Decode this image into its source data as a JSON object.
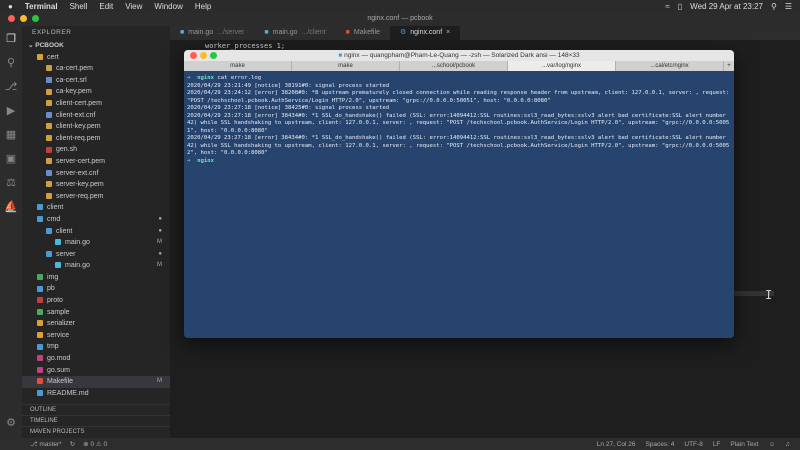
{
  "menubar": {
    "apple": "",
    "app_name": "Terminal",
    "items": [
      "Shell",
      "Edit",
      "View",
      "Window",
      "Help"
    ],
    "clock": "Wed 29 Apr at 23:27"
  },
  "window_title": "nginx.conf — pcbook",
  "sidebar": {
    "header": "EXPLORER",
    "root": "PCBOOK",
    "items": [
      {
        "label": "cert",
        "color": "#e0a030",
        "indent": 1,
        "badge": ""
      },
      {
        "label": "ca-cert.pem",
        "color": "#d0a040",
        "indent": 2,
        "badge": ""
      },
      {
        "label": "ca-cert.srl",
        "color": "#6c8cc8",
        "indent": 2,
        "badge": ""
      },
      {
        "label": "ca-key.pem",
        "color": "#d0a040",
        "indent": 2,
        "badge": ""
      },
      {
        "label": "client-cert.pem",
        "color": "#d0a040",
        "indent": 2,
        "badge": ""
      },
      {
        "label": "client-ext.cnf",
        "color": "#6c8cc8",
        "indent": 2,
        "badge": ""
      },
      {
        "label": "client-key.pem",
        "color": "#d0a040",
        "indent": 2,
        "badge": ""
      },
      {
        "label": "client-req.pem",
        "color": "#d0a040",
        "indent": 2,
        "badge": ""
      },
      {
        "label": "gen.sh",
        "color": "#c04040",
        "indent": 2,
        "badge": ""
      },
      {
        "label": "server-cert.pem",
        "color": "#d0a040",
        "indent": 2,
        "badge": ""
      },
      {
        "label": "server-ext.cnf",
        "color": "#6c8cc8",
        "indent": 2,
        "badge": ""
      },
      {
        "label": "server-key.pem",
        "color": "#d0a040",
        "indent": 2,
        "badge": ""
      },
      {
        "label": "server-req.pem",
        "color": "#d0a040",
        "indent": 2,
        "badge": ""
      },
      {
        "label": "client",
        "color": "#4a9ad8",
        "indent": 1,
        "badge": ""
      },
      {
        "label": "cmd",
        "color": "#4a9ad8",
        "indent": 1,
        "badge": "●"
      },
      {
        "label": "client",
        "color": "#4a9ad8",
        "indent": 2,
        "badge": "●"
      },
      {
        "label": "main.go",
        "color": "#4ab8d8",
        "indent": 3,
        "badge": "M"
      },
      {
        "label": "server",
        "color": "#4a9ad8",
        "indent": 2,
        "badge": "●"
      },
      {
        "label": "main.go",
        "color": "#4ab8d8",
        "indent": 3,
        "badge": "M"
      },
      {
        "label": "img",
        "color": "#4aa860",
        "indent": 1,
        "badge": ""
      },
      {
        "label": "pb",
        "color": "#4a9ad8",
        "indent": 1,
        "badge": ""
      },
      {
        "label": "proto",
        "color": "#c04040",
        "indent": 1,
        "badge": ""
      },
      {
        "label": "sample",
        "color": "#4aa860",
        "indent": 1,
        "badge": ""
      },
      {
        "label": "serializer",
        "color": "#e0a030",
        "indent": 1,
        "badge": ""
      },
      {
        "label": "service",
        "color": "#e0a030",
        "indent": 1,
        "badge": ""
      },
      {
        "label": "tmp",
        "color": "#4a9ad8",
        "indent": 1,
        "badge": ""
      },
      {
        "label": "go.mod",
        "color": "#c04080",
        "indent": 1,
        "badge": ""
      },
      {
        "label": "go.sum",
        "color": "#c04080",
        "indent": 1,
        "badge": ""
      },
      {
        "label": "Makefile",
        "color": "#e05040",
        "indent": 1,
        "badge": "M"
      },
      {
        "label": "README.md",
        "color": "#4a9ad8",
        "indent": 1,
        "badge": ""
      }
    ],
    "sections": [
      "OUTLINE",
      "TIMELINE",
      "MAVEN PROJECTS"
    ]
  },
  "tabs": [
    {
      "label": "main.go",
      "hint": ".../server",
      "active": false
    },
    {
      "label": "main.go",
      "hint": ".../client",
      "active": false
    },
    {
      "label": "Makefile",
      "hint": "",
      "active": false
    },
    {
      "label": "nginx.conf",
      "hint": "",
      "active": true
    }
  ],
  "editor": {
    "first_line": "worker_processes  1;"
  },
  "terminal": {
    "title": "nginx — quangpham@Pham-Le-Quang — -zsh — Solarized Dark ansi — 148×33",
    "tabs": [
      "make",
      "make",
      "...school/pcbook",
      "...var/log/nginx",
      "...cal/etc/nginx"
    ],
    "active_tab": 3,
    "prompt_dir": "nginx",
    "command": "cat error.log",
    "output": [
      "2020/04/29 23:21:49 [notice] 38191#0: signal process started",
      "2020/04/29 23:24:12 [error] 38208#0: *8 upstream prematurely closed connection while reading response header from upstream, client: 127.0.0.1, server: , request: \"POST /techschool.pcbook.AuthService/Login HTTP/2.0\", upstream: \"grpc://0.0.0.0:50051\", host: \"0.0.0.0:8080\"",
      "2020/04/29 23:27:18 [notice] 38425#0: signal process started",
      "2020/04/29 23:27:18 [error] 38434#0: *1 SSL_do_handshake() failed (SSL: error:14094412:SSL routines:ssl3_read_bytes:sslv3 alert bad certificate:SSL alert number 42) while SSL handshaking to upstream, client: 127.0.0.1, server: , request: \"POST /techschool.pcbook.AuthService/Login HTTP/2.0\", upstream: \"grpc://0.0.0.0:50051\", host: \"0.0.0.0:8080\"",
      "2020/04/29 23:27:18 [error] 38434#0: *1 SSL_do_handshake() failed (SSL: error:14094412:SSL routines:ssl3_read_bytes:sslv3 alert bad certificate:SSL alert number 42) while SSL handshaking to upstream, client: 127.0.0.1, server: , request: \"POST /techschool.pcbook.AuthService/Login HTTP/2.0\", upstream: \"grpc://0.0.0.0:50052\", host: \"0.0.0.0:8080\""
    ]
  },
  "statusbar": {
    "branch": "master*",
    "errors": "0",
    "warnings": "0",
    "cursor": "Ln 27, Col 26",
    "spaces": "Spaces: 4",
    "encoding": "UTF-8",
    "eol": "LF",
    "language": "Plain Text"
  },
  "colors": {
    "terminal_bg": "#27446e",
    "prompt": "#6be0c0"
  }
}
